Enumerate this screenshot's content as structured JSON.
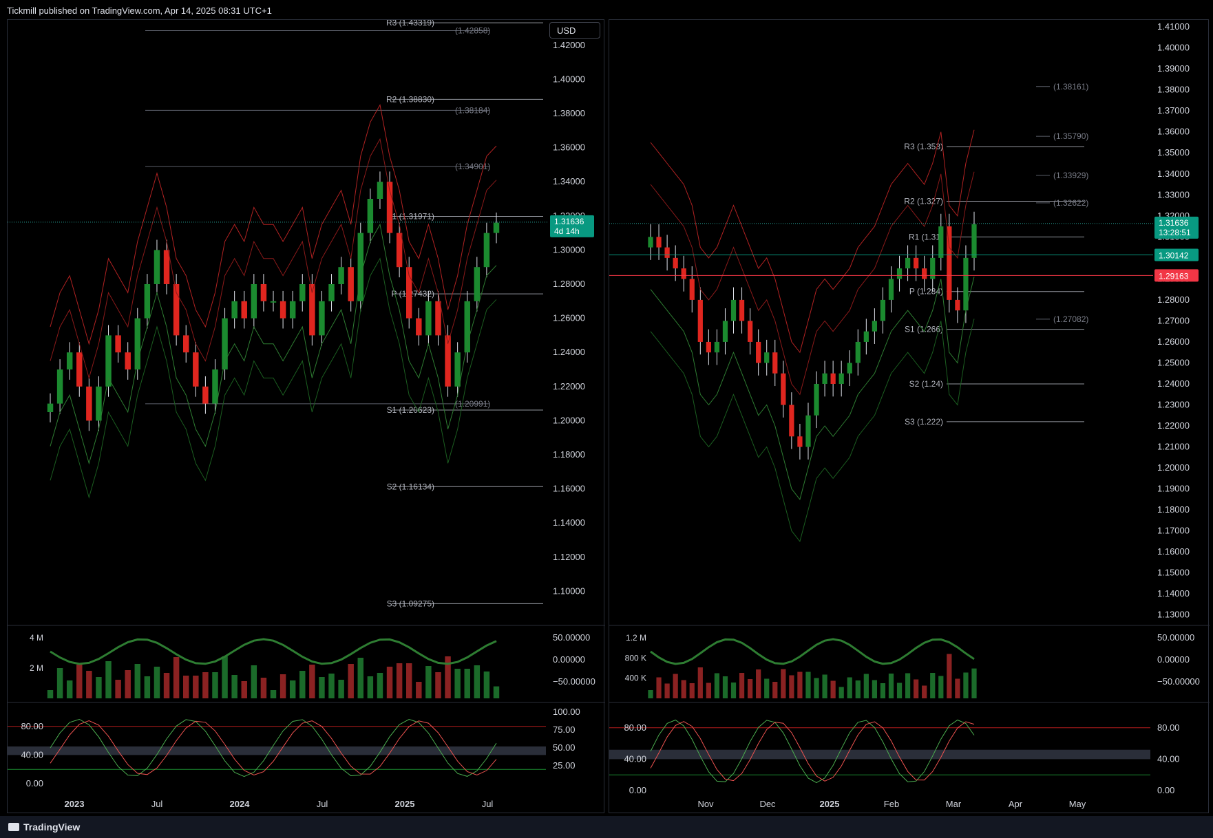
{
  "header": {
    "publisher": "Tickmill published on TradingView.com, Apr 14, 2025 08:31 UTC+1"
  },
  "footer": {
    "brand": "TradingView"
  },
  "currency_button": "USD",
  "chart_data": [
    {
      "type": "candlestick",
      "price_axis": {
        "range": [
          1.08,
          1.43
        ],
        "ticks": [
          "1.42000",
          "1.40000",
          "1.38000",
          "1.36000",
          "1.34000",
          "1.32000",
          "1.30000",
          "1.28000",
          "1.26000",
          "1.24000",
          "1.22000",
          "1.20000",
          "1.18000",
          "1.16000",
          "1.14000",
          "1.12000",
          "1.10000"
        ]
      },
      "time_axis": {
        "labels": [
          "2023",
          "Jul",
          "2024",
          "Jul",
          "2025",
          "Jul"
        ]
      },
      "pivot_levels": [
        {
          "label": "R3 (1.43319)",
          "value": 1.43319
        },
        {
          "label": "(1.42858)",
          "value": 1.42858
        },
        {
          "label": "R2 (1.38830)",
          "value": 1.3883
        },
        {
          "label": "(1.38184)",
          "value": 1.38184
        },
        {
          "label": "(1.34901)",
          "value": 1.34901
        },
        {
          "label": "R1 (1.31971)",
          "value": 1.31971
        },
        {
          "label": "P (1.27432)",
          "value": 1.27432
        },
        {
          "label": "(1.20991)",
          "value": 1.20991
        },
        {
          "label": "S1 (1.20623)",
          "value": 1.20623
        },
        {
          "label": "S2 (1.16134)",
          "value": 1.16134
        },
        {
          "label": "S3 (1.09275)",
          "value": 1.09275
        }
      ],
      "last_price": {
        "value": 1.31636,
        "label": "1.31636",
        "countdown": "4d 14h"
      },
      "closes": [
        1.21,
        1.23,
        1.24,
        1.22,
        1.2,
        1.22,
        1.25,
        1.24,
        1.23,
        1.26,
        1.28,
        1.3,
        1.28,
        1.25,
        1.24,
        1.22,
        1.21,
        1.23,
        1.26,
        1.27,
        1.26,
        1.28,
        1.27,
        1.27,
        1.26,
        1.27,
        1.28,
        1.25,
        1.27,
        1.28,
        1.29,
        1.27,
        1.31,
        1.33,
        1.34,
        1.31,
        1.29,
        1.26,
        1.25,
        1.27,
        1.25,
        1.22,
        1.24,
        1.27,
        1.29,
        1.31,
        1.316
      ],
      "volume_pane": {
        "ticks": [
          "4 M",
          "2 M"
        ],
        "right_ticks": [
          "50.00000",
          "0.00000",
          "−50.00000"
        ]
      },
      "osc_pane": {
        "left_ticks": [
          "80.00",
          "40.00",
          "0.00"
        ],
        "right_ticks": [
          "100.00",
          "75.00",
          "50.00",
          "25.00"
        ]
      }
    },
    {
      "type": "candlestick",
      "price_axis": {
        "range": [
          1.125,
          1.412
        ],
        "ticks": [
          "1.41000",
          "1.40000",
          "1.39000",
          "1.38000",
          "1.37000",
          "1.36000",
          "1.35000",
          "1.34000",
          "1.33000",
          "1.32000",
          "1.31000",
          "1.30000",
          "1.29000",
          "1.28000",
          "1.27000",
          "1.26000",
          "1.25000",
          "1.24000",
          "1.23000",
          "1.22000",
          "1.21000",
          "1.20000",
          "1.19000",
          "1.18000",
          "1.17000",
          "1.16000",
          "1.15000",
          "1.14000",
          "1.13000"
        ]
      },
      "time_axis": {
        "labels": [
          "Nov",
          "Dec",
          "2025",
          "Feb",
          "Mar",
          "Apr",
          "May"
        ]
      },
      "pivot_levels": [
        {
          "label": "(1.38161)",
          "value": 1.38161
        },
        {
          "label": "(1.35790)",
          "value": 1.3579
        },
        {
          "label": "R3 (1.353)",
          "value": 1.353
        },
        {
          "label": "(1.33929)",
          "value": 1.33929
        },
        {
          "label": "R2 (1.327)",
          "value": 1.327
        },
        {
          "label": "(1.32622)",
          "value": 1.32622
        },
        {
          "label": "R1 (1.31)",
          "value": 1.31
        },
        {
          "label": "P (1.284)",
          "value": 1.284
        },
        {
          "label": "(1.27082)",
          "value": 1.27082
        },
        {
          "label": "S1 (1.266)",
          "value": 1.266
        },
        {
          "label": "S2 (1.24)",
          "value": 1.24
        },
        {
          "label": "S3 (1.222)",
          "value": 1.222
        }
      ],
      "last_price": {
        "value": 1.31636,
        "label": "1.31636",
        "countdown": "13:28:51"
      },
      "price_labels": [
        {
          "value": 1.30142,
          "label": "1.30142",
          "color": "#089981"
        },
        {
          "value": 1.29163,
          "label": "1.29163",
          "color": "#f23645"
        }
      ],
      "closes": [
        1.31,
        1.305,
        1.3,
        1.295,
        1.29,
        1.28,
        1.26,
        1.255,
        1.26,
        1.27,
        1.28,
        1.27,
        1.26,
        1.25,
        1.255,
        1.245,
        1.23,
        1.215,
        1.21,
        1.225,
        1.24,
        1.245,
        1.24,
        1.245,
        1.25,
        1.26,
        1.265,
        1.27,
        1.28,
        1.29,
        1.295,
        1.3,
        1.295,
        1.29,
        1.3,
        1.315,
        1.28,
        1.275,
        1.3,
        1.316
      ],
      "volume_pane": {
        "ticks": [
          "1.2 M",
          "800 K",
          "400 K"
        ],
        "right_ticks": [
          "50.00000",
          "0.00000",
          "−50.00000"
        ]
      },
      "osc_pane": {
        "left_ticks": [
          "80.00",
          "40.00",
          "0.00"
        ],
        "right_ticks": [
          "80.00",
          "40.00",
          "0.00"
        ]
      }
    }
  ]
}
